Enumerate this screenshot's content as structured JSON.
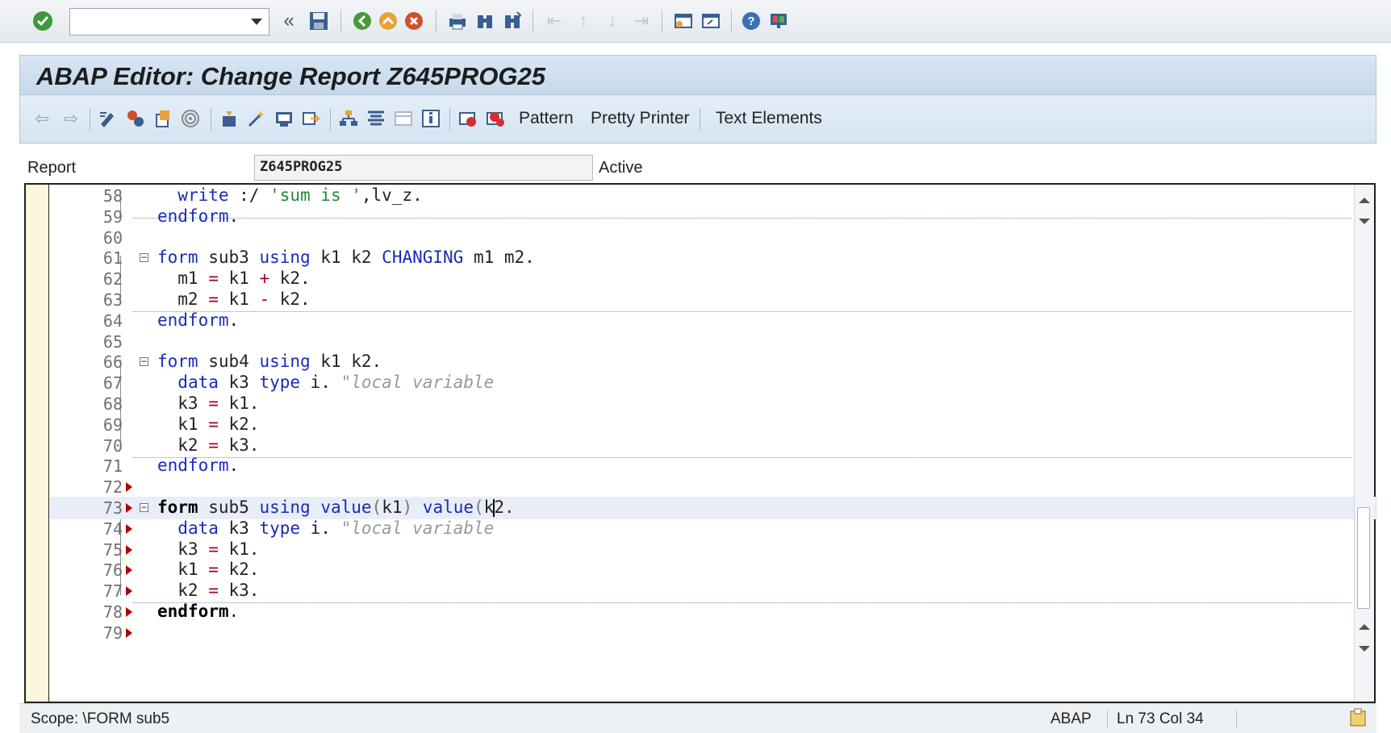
{
  "standard_toolbar": {
    "command_field": {
      "value": "",
      "placeholder": ""
    },
    "icons": [
      "enter-check-icon",
      "back-double-chevron-icon",
      "save-icon",
      "back-icon",
      "exit-icon",
      "cancel-icon",
      "print-icon",
      "find-icon",
      "find-next-icon",
      "first-page-icon",
      "previous-page-icon",
      "next-page-icon",
      "last-page-icon",
      "create-session-icon",
      "shortcut-icon",
      "help-icon",
      "customize-layout-icon"
    ]
  },
  "title_bar": {
    "title": "ABAP Editor: Change Report Z645PROG25"
  },
  "app_toolbar": {
    "pattern_label": "Pattern",
    "pretty_printer_label": "Pretty Printer",
    "text_elements_label": "Text Elements"
  },
  "report_row": {
    "label": "Report",
    "program_name": "Z645PROG25",
    "status": "Active"
  },
  "editor": {
    "lines": [
      {
        "num": "58",
        "code": "  write :/ 'sum is ',lv_z."
      },
      {
        "num": "59",
        "code": "endform."
      },
      {
        "num": "60",
        "code": ""
      },
      {
        "num": "61",
        "code": "form sub3 using k1 k2 CHANGING m1 m2."
      },
      {
        "num": "62",
        "code": "  m1 = k1 + k2."
      },
      {
        "num": "63",
        "code": "  m2 = k1 - k2."
      },
      {
        "num": "64",
        "code": "endform."
      },
      {
        "num": "65",
        "code": ""
      },
      {
        "num": "66",
        "code": "form sub4 using k1 k2."
      },
      {
        "num": "67",
        "code": "  data k3 type i. \"local variable"
      },
      {
        "num": "68",
        "code": "  k3 = k1."
      },
      {
        "num": "69",
        "code": "  k1 = k2."
      },
      {
        "num": "70",
        "code": "  k2 = k3."
      },
      {
        "num": "71",
        "code": "endform."
      },
      {
        "num": "72",
        "code": ""
      },
      {
        "num": "73",
        "code": "form sub5 using value(k1) value(k2."
      },
      {
        "num": "74",
        "code": "  data k3 type i. \"local variable"
      },
      {
        "num": "75",
        "code": "  k3 = k1."
      },
      {
        "num": "76",
        "code": "  k1 = k2."
      },
      {
        "num": "77",
        "code": "  k2 = k3."
      },
      {
        "num": "78",
        "code": "endform."
      },
      {
        "num": "79",
        "code": ""
      }
    ]
  },
  "status_bar": {
    "scope": "Scope: \\FORM sub5",
    "language": "ABAP",
    "position": "Ln  73 Col  34"
  },
  "colors": {
    "keyword": "#1a2bb8",
    "string": "#1f8a3a",
    "comment": "#999999",
    "operator": "#a00030",
    "current_line": "#e8edf7",
    "breakpoint": "#b00000"
  }
}
